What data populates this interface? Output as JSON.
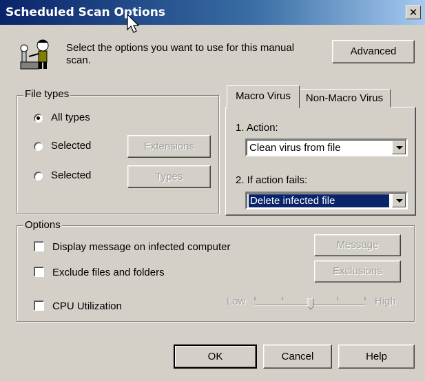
{
  "window": {
    "title": "Scheduled Scan Options",
    "close_glyph": "✕"
  },
  "header": {
    "description": "Select the options you want to use for this manual scan.",
    "advanced_label": "Advanced",
    "icon": "scanner-man-icon"
  },
  "file_types": {
    "legend": "File types",
    "options": [
      {
        "label": "All types",
        "selected": true
      },
      {
        "label": "Selected",
        "selected": false,
        "button": "Extensions"
      },
      {
        "label": "Selected",
        "selected": false,
        "button": "Types"
      }
    ]
  },
  "tabs": [
    {
      "label": "Macro Virus",
      "active": true
    },
    {
      "label": "Non-Macro Virus",
      "active": false
    }
  ],
  "macro": {
    "action_label": "1. Action:",
    "action_value": "Clean virus from file",
    "fail_label": "2. If action fails:",
    "fail_value": "Delete infected file"
  },
  "options": {
    "legend": "Options",
    "items": [
      {
        "label": "Display message on infected computer",
        "checked": false,
        "button": "Message"
      },
      {
        "label": "Exclude files and folders",
        "checked": false,
        "button": "Exclusions"
      },
      {
        "label": "CPU Utilization",
        "checked": false
      }
    ],
    "slider": {
      "low": "Low",
      "high": "High",
      "level": 0.5
    }
  },
  "footer": {
    "ok": "OK",
    "cancel": "Cancel",
    "help": "Help"
  }
}
